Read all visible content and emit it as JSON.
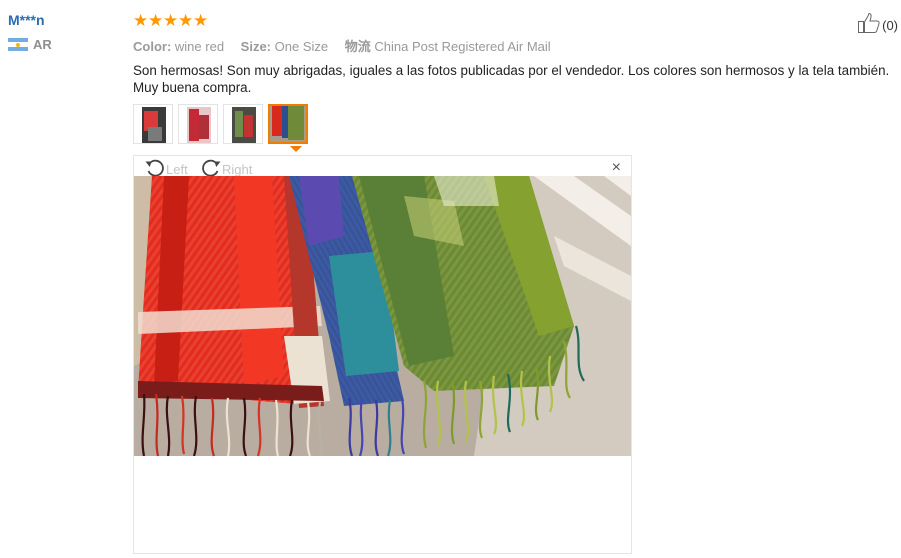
{
  "user": {
    "name": "M***n",
    "country": "AR"
  },
  "review": {
    "stars": [
      "★",
      "★",
      "★",
      "★",
      "★"
    ],
    "color_key": "Color:",
    "color_val": "wine red",
    "size_key": "Size:",
    "size_val": "One Size",
    "ship_key": "物流",
    "ship_val": "China Post Registered Air Mail",
    "text": "Son hermosas! Son muy abrigadas, iguales a las fotos publicadas por el vendedor. Los colores son hermosos y la tela también. Muy buena compra."
  },
  "helpful": {
    "count": "(0)",
    "icon": "thumbs-up-icon"
  },
  "viewer": {
    "rotate_left": "Left",
    "rotate_right": "Right",
    "close": "×"
  },
  "colors": {
    "accent": "#f07c00",
    "star": "#ff9900",
    "username": "#2a6cb4"
  }
}
